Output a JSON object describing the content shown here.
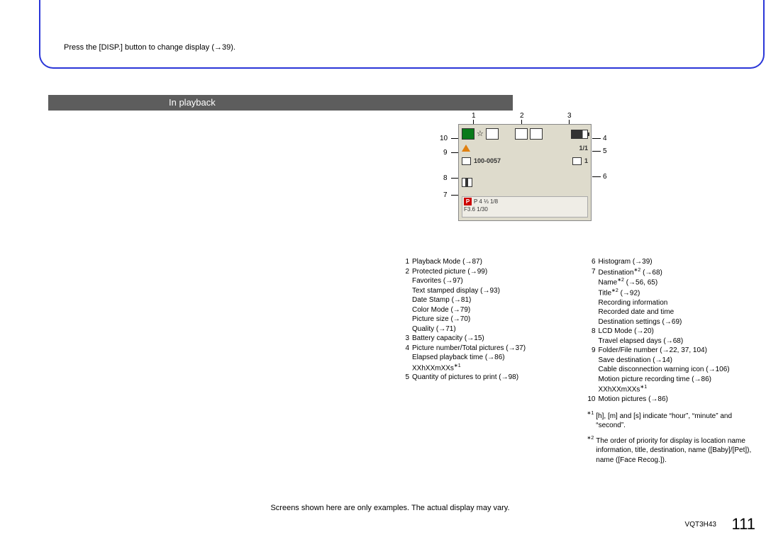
{
  "top_instruction": "Press the [DISP.] button to change display (→39).",
  "section_title": "In playback",
  "diagram": {
    "row2_folder": "100-0057",
    "row2_count": "1/1",
    "row3_print": "1",
    "bottom_line1": "P  4 ⅓  1/8",
    "bottom_line2": "F3.6  1/30"
  },
  "callouts": [
    "1",
    "2",
    "3",
    "4",
    "5",
    "6",
    "7",
    "8",
    "9",
    "10"
  ],
  "legend_left": [
    {
      "n": "1",
      "lines": [
        "Playback Mode (→87)"
      ]
    },
    {
      "n": "2",
      "lines": [
        "Protected picture (→99)",
        "Favorites (→97)",
        "Text stamped display (→93)",
        "Date Stamp (→81)",
        "Color Mode (→79)",
        "Picture size (→70)",
        "Quality (→71)"
      ]
    },
    {
      "n": "3",
      "lines": [
        "Battery capacity (→15)"
      ]
    },
    {
      "n": "4",
      "lines": [
        "Picture number/Total pictures (→37)",
        "Elapsed playback time (→86)",
        "XXhXXmXXs∗1"
      ]
    },
    {
      "n": "5",
      "lines": [
        "Quantity of pictures to print (→98)"
      ]
    }
  ],
  "legend_right": [
    {
      "n": "6",
      "lines": [
        "Histogram (→39)"
      ]
    },
    {
      "n": "7",
      "lines": [
        "Destination∗2 (→68)",
        "Name∗2 (→56, 65)",
        "Title∗2 (→92)",
        "Recording information",
        "Recorded date and time",
        "Destination settings (→69)"
      ]
    },
    {
      "n": "8",
      "lines": [
        "LCD Mode (→20)",
        "Travel elapsed days (→68)"
      ]
    },
    {
      "n": "9",
      "lines": [
        "Folder/File number (→22, 37, 104)",
        "Save destination (→14)",
        "Cable disconnection warning icon (→106)",
        "Motion picture recording time (→86)",
        "XXhXXmXXs∗1"
      ]
    },
    {
      "n": "10",
      "lines": [
        "Motion pictures (→86)"
      ]
    }
  ],
  "footnotes": [
    {
      "sup": "∗1",
      "text": "[h], [m] and [s] indicate “hour”, “minute” and “second”."
    },
    {
      "sup": "∗2",
      "text": "The order of priority for display is location name information, title, destination, name ([Baby]/[Pet]), name ([Face Recog.])."
    }
  ],
  "bottom_note": "Screens shown here are only examples. The actual display may vary.",
  "doc_id": "VQT3H43",
  "page_number": "111"
}
